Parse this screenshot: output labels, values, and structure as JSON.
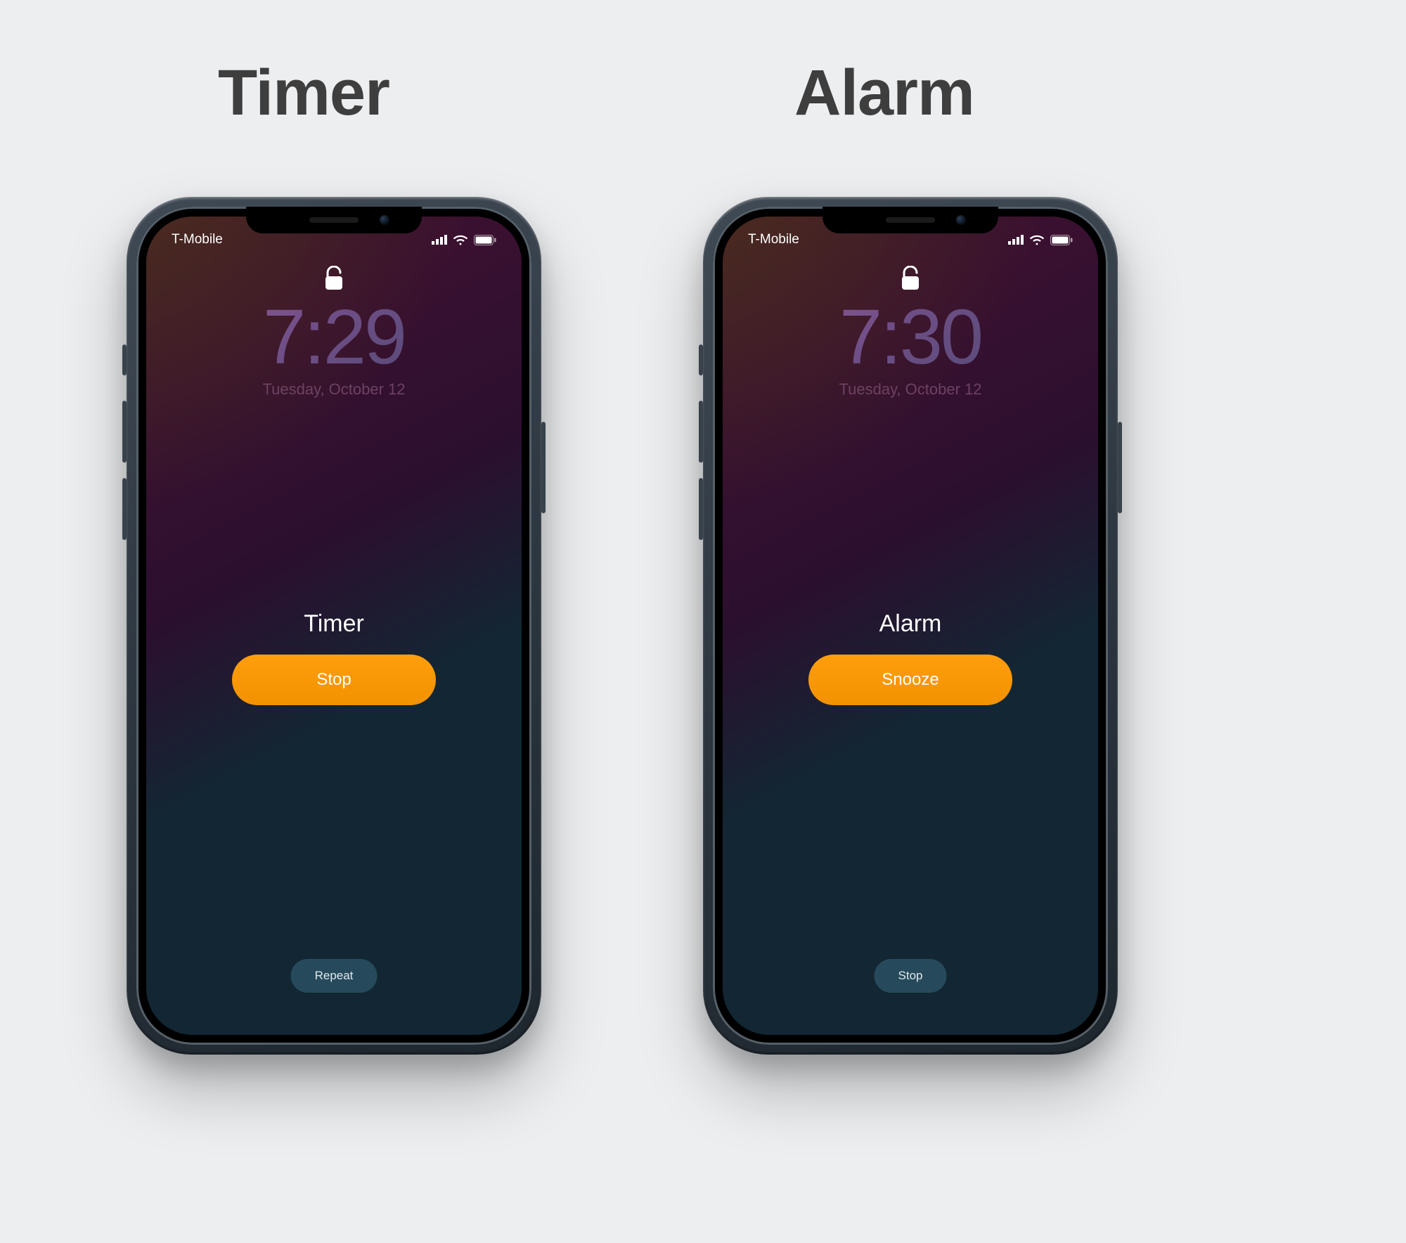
{
  "headings": {
    "left": "Timer",
    "right": "Alarm"
  },
  "status": {
    "carrier": "T-Mobile",
    "icons": {
      "signal": "signal-icon",
      "wifi": "wifi-icon",
      "battery": "battery-icon"
    }
  },
  "lock_icon": "lock-open-icon",
  "phones": {
    "left": {
      "time": "7:29",
      "date": "Tuesday, October 12",
      "alert_title": "Timer",
      "primary_button": "Stop",
      "secondary_button": "Repeat"
    },
    "right": {
      "time": "7:30",
      "date": "Tuesday, October 12",
      "alert_title": "Alarm",
      "primary_button": "Snooze",
      "secondary_button": "Stop"
    }
  },
  "colors": {
    "accent_orange": "#f39200",
    "secondary_button": "#264a5c",
    "page_bg": "#eceef0"
  }
}
